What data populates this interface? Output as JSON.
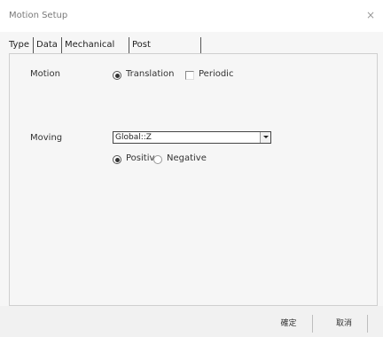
{
  "window": {
    "title": "Motion Setup",
    "close_glyph": "×"
  },
  "tabs": [
    {
      "label": "Type",
      "selected": true
    },
    {
      "label": "Data",
      "selected": false
    },
    {
      "label": "Mechanical",
      "selected": false
    },
    {
      "label": "Post Processing",
      "selected": false
    }
  ],
  "motion": {
    "label": "Motion",
    "options": [
      {
        "label": "Translation",
        "type": "radio",
        "checked": true
      },
      {
        "label": "Periodic",
        "type": "checkbox",
        "checked": false
      }
    ]
  },
  "moving": {
    "label": "Moving",
    "selected_value": "Global::Z",
    "direction_options": [
      {
        "label": "Positive",
        "checked": true
      },
      {
        "label": "Negative",
        "checked": false
      }
    ]
  },
  "buttons": {
    "ok_label": "確定",
    "cancel_label": "取消"
  },
  "icons": {
    "close": "close-icon",
    "dropdown": "chevron-down-icon"
  }
}
